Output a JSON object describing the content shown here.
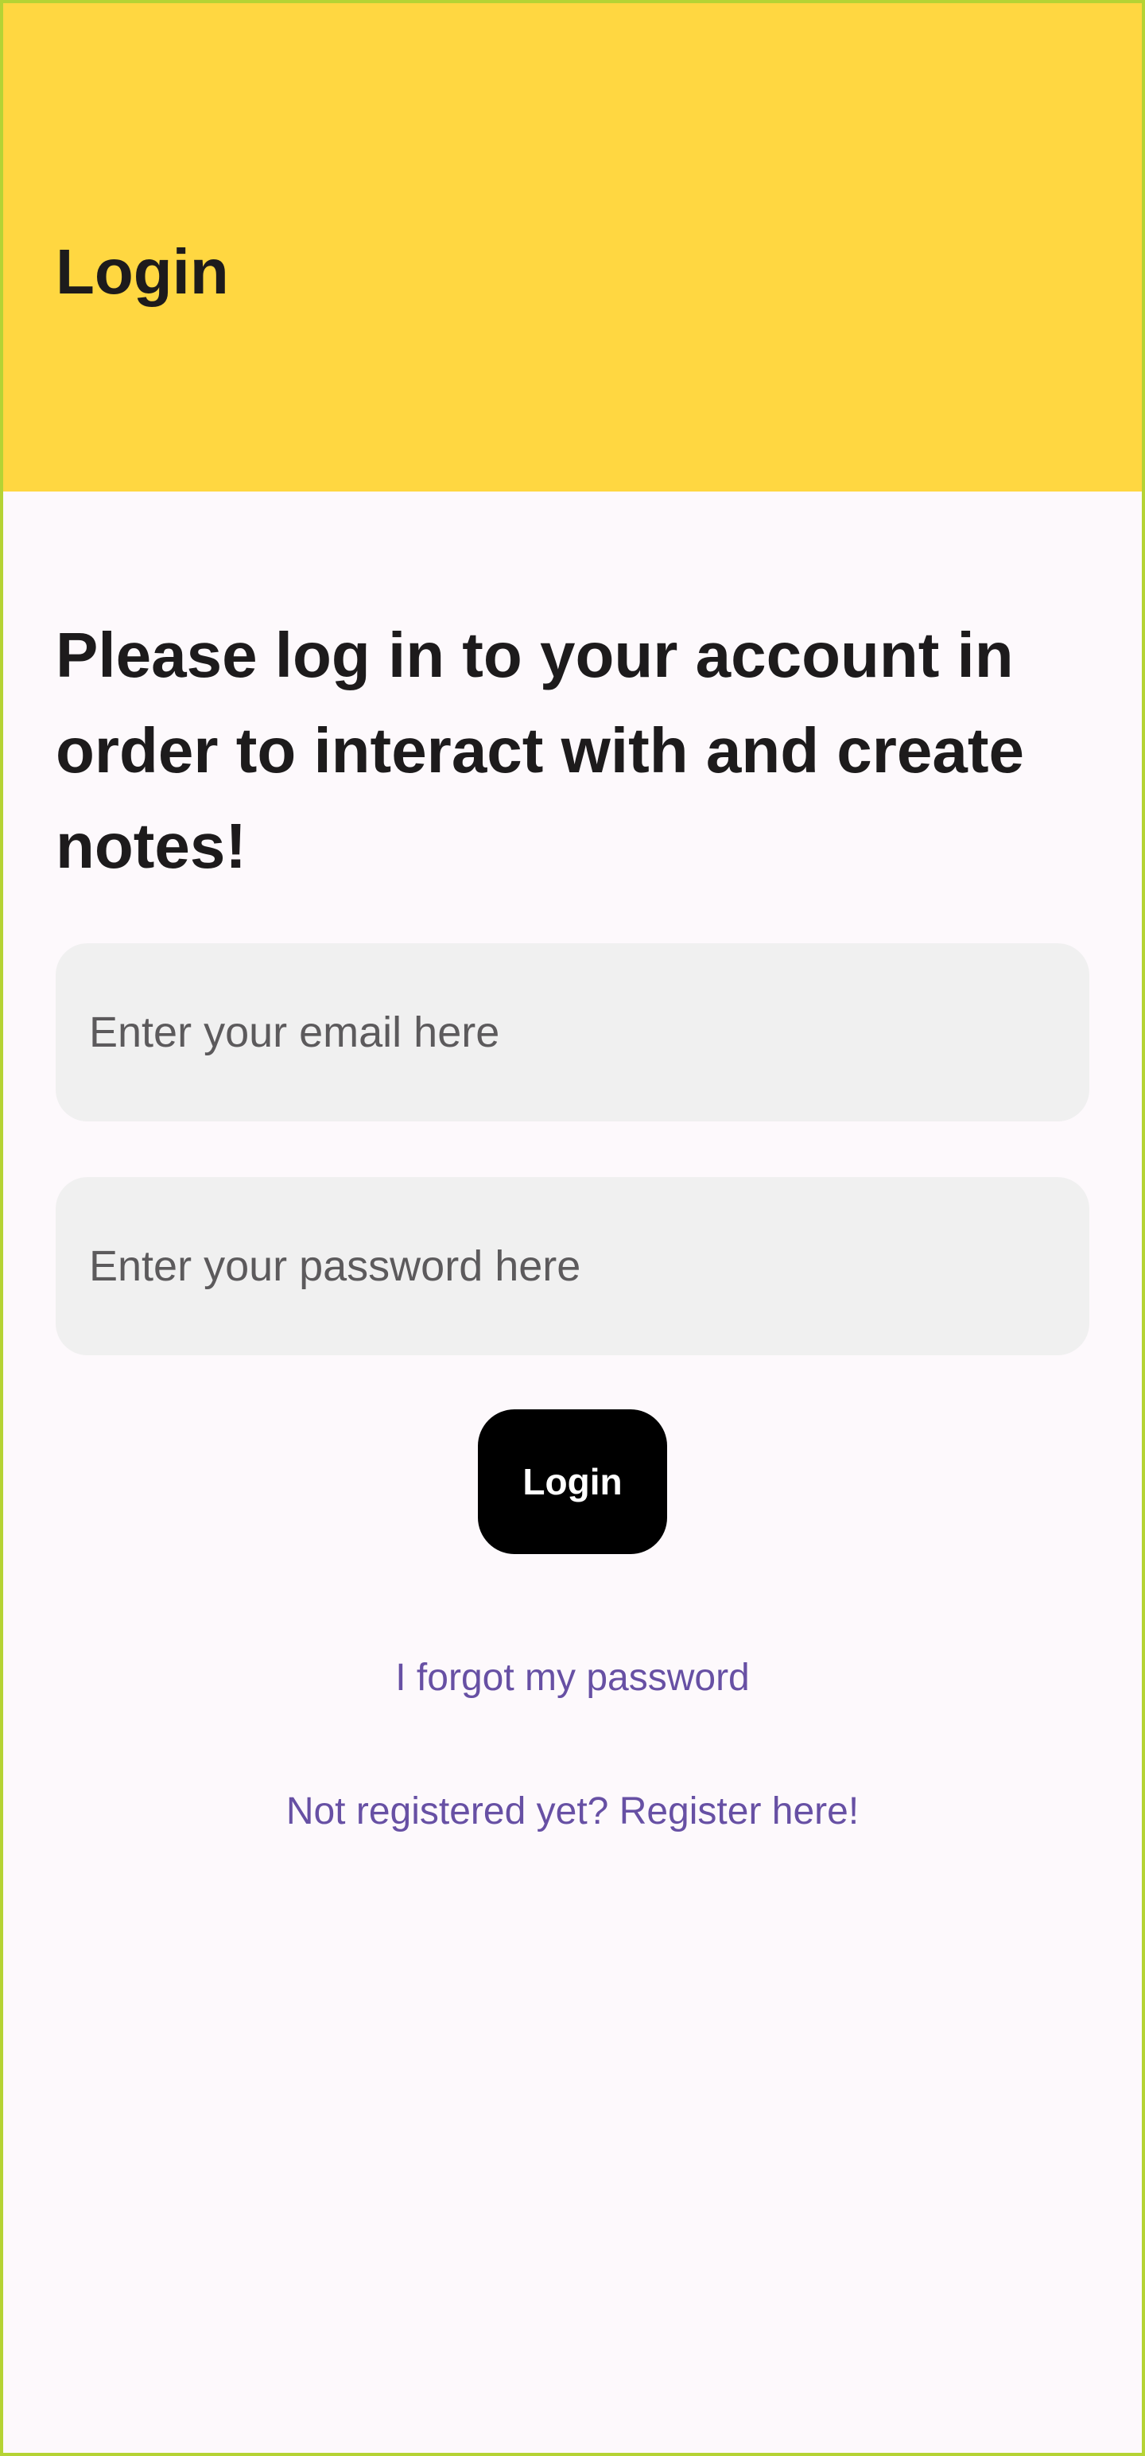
{
  "app_bar": {
    "title": "Login",
    "background_color": "#ffd741"
  },
  "intro": {
    "text": "Please log in to your account in order to interact with and create notes!"
  },
  "email_field": {
    "value": "",
    "placeholder": "Enter your email here"
  },
  "password_field": {
    "value": "",
    "placeholder": "Enter your password here"
  },
  "login_button": {
    "label": "Login"
  },
  "links": {
    "forgot_password": "I forgot my password",
    "register": "Not registered yet? Register here!"
  },
  "colors": {
    "link": "#6750a4",
    "button": "#000000",
    "field_background": "#f0f0f0",
    "page_background": "#fdf9fc"
  }
}
